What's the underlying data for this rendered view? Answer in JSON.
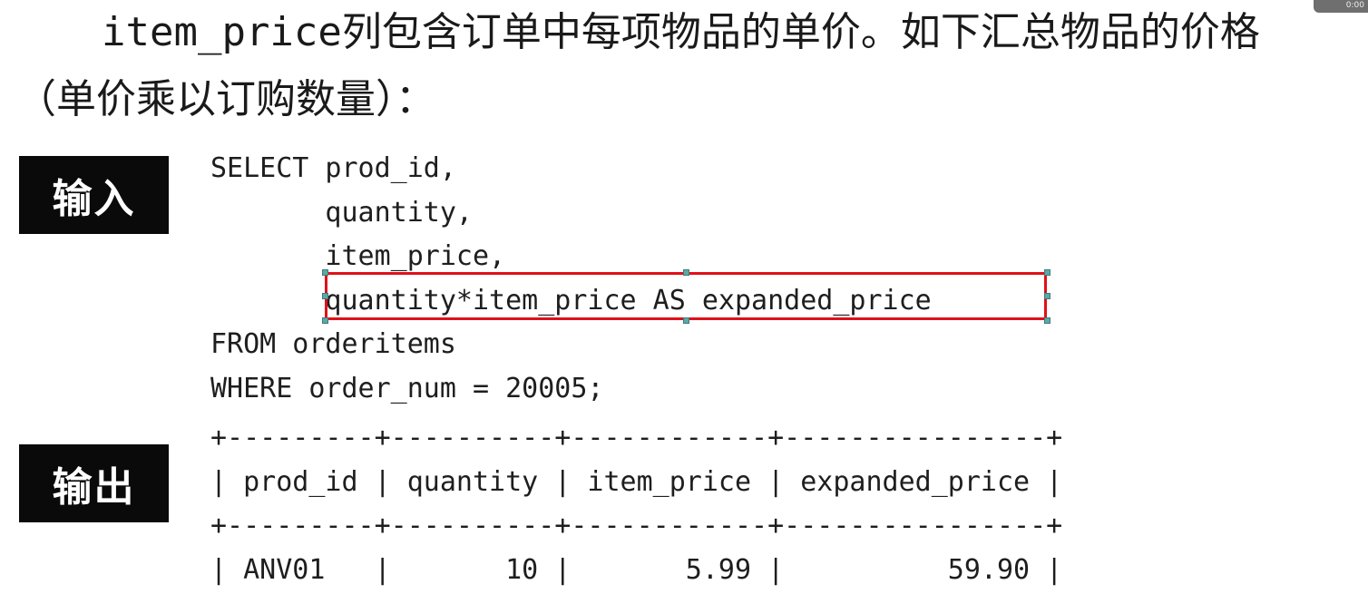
{
  "paragraph": {
    "line1_code": "item_price",
    "line1_text": "列包含订单中每项物品的单价。如下汇总物品的价格",
    "line2": "（单价乘以订购数量）："
  },
  "labels": {
    "input": "输入",
    "output": "输出"
  },
  "code": {
    "lines": [
      "SELECT prod_id,",
      "       quantity,",
      "       item_price,",
      "       quantity*item_price AS expanded_price",
      "FROM orderitems",
      "WHERE order_num = 20005;"
    ]
  },
  "result": {
    "lines": [
      "+---------+----------+------------+----------------+",
      "| prod_id | quantity | item_price | expanded_price |",
      "+---------+----------+------------+----------------+",
      "| ANV01   |       10 |       5.99 |          59.90 |"
    ]
  },
  "overlay": {
    "highlight_color": "#e0101a",
    "handle_color": "#5aa9a8",
    "badge": "0:00"
  }
}
